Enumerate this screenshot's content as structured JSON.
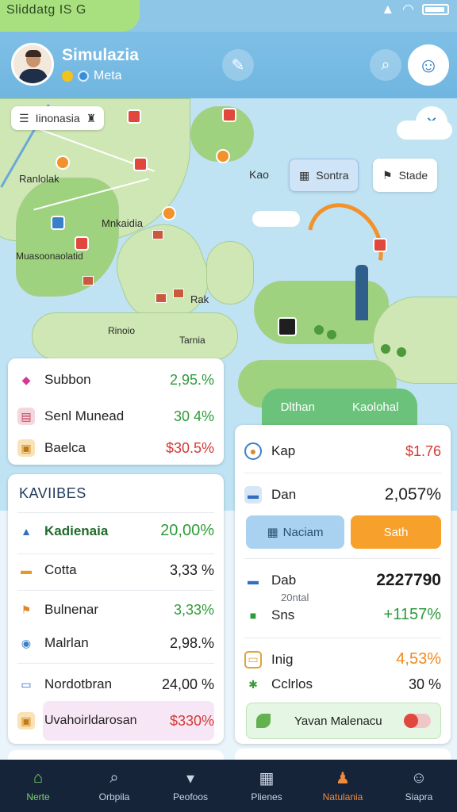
{
  "status_bar": {
    "time": "Sliddatg  IS G",
    "icons": [
      "wifi-icon",
      "signal-icon",
      "battery-icon"
    ]
  },
  "header": {
    "title": "Simulazia",
    "subtitle": "Meta"
  },
  "map": {
    "region_chip": "Iinonasia",
    "label_kao": "Kao",
    "chip_sontra": "Sontra",
    "chip_stade": "Stade",
    "places": [
      "Ranlolak",
      "Mnkaidia",
      "Muasoonaolatid",
      "Rak",
      "Rinoio",
      "Tarnia"
    ],
    "tabs": [
      "Dlthan",
      "Kaolohal"
    ]
  },
  "left_card_top": {
    "rows": [
      {
        "label": "Subbon",
        "value": "2,95.%",
        "color": "#2e9b3a",
        "icon": "diamond-icon"
      },
      {
        "label": "Senl Munead",
        "value": "30 4%",
        "color": "#2e9b3a",
        "icon": "building-icon"
      },
      {
        "label": "Baelca",
        "value": "$30.5%",
        "color": "#d23a35",
        "icon": "crate-icon"
      }
    ]
  },
  "left_card_list": {
    "title": "KAVIIBES",
    "rows": [
      {
        "label": "Kadienaia",
        "value": "20,00%",
        "color": "#2e9b3a",
        "icon": "rocket-icon"
      },
      {
        "label": "Cotta",
        "value": "3,33 %",
        "color": "#2e9b3a",
        "icon": "chest-icon"
      },
      {
        "label": "Bulnenar",
        "value": "3,33%",
        "color": "#2e9b3a",
        "icon": "flag-icon"
      },
      {
        "label": "Malrlan",
        "value": "2,98.%",
        "color": "#1c1c1c",
        "icon": "globe-icon"
      },
      {
        "label": "Nordotbran",
        "value": "24,00 %",
        "color": "#1c1c1c",
        "icon": "tv-icon"
      },
      {
        "label": "Uvahoirldarosan",
        "value": "$330%",
        "color": "#d23a35",
        "icon": "crate-icon"
      }
    ]
  },
  "right_card": {
    "rows": [
      {
        "label": "Kap",
        "value": "$1.76",
        "color": "#d23a35",
        "icon": "location-icon"
      },
      {
        "label": "Dan",
        "value": "2,057%",
        "color": "#1c1c1c",
        "icon": "truck-icon"
      }
    ],
    "button_blue": "Naciam",
    "button_orange": "Sath",
    "stats": [
      {
        "label": "Dab",
        "sub": "20ntal",
        "value": "2227790",
        "color": "#1c1c1c",
        "icon": "truck-icon"
      },
      {
        "label": "Sns",
        "value": "+1157%",
        "color": "#2e9b3a",
        "icon": "tank-icon"
      },
      {
        "label": "Inig",
        "value": "4,53%",
        "color": "#f08a1c",
        "icon": "clipboard-icon"
      },
      {
        "label": "Cclrlos",
        "value": "30 %",
        "color": "#1c1c1c",
        "icon": "palm-icon"
      }
    ],
    "banner": "Yavan Malenacu"
  },
  "bottom_nav": [
    {
      "label": "Nerte",
      "icon": "home-icon",
      "state": "active"
    },
    {
      "label": "Orbpila",
      "icon": "search-icon",
      "state": ""
    },
    {
      "label": "Peofoos",
      "icon": "chat-icon",
      "state": ""
    },
    {
      "label": "Plienes",
      "icon": "grid-icon",
      "state": ""
    },
    {
      "label": "Natulania",
      "icon": "person-alert-icon",
      "state": "alert"
    },
    {
      "label": "Siapra",
      "icon": "profile-icon",
      "state": ""
    }
  ]
}
